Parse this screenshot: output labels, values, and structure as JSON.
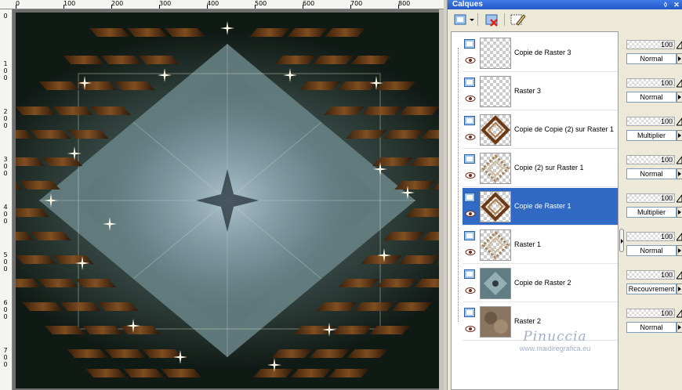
{
  "ruler": {
    "top_labels": [
      "0",
      "100",
      "200",
      "300",
      "400",
      "500",
      "600",
      "700",
      "800"
    ],
    "left_labels": [
      "0",
      "100",
      "200",
      "300",
      "400",
      "500",
      "600",
      "700"
    ]
  },
  "palette": {
    "title": "Calques",
    "title_buttons": {
      "pin": "◊",
      "close": "✕"
    },
    "tools": [
      "new-layer-icon",
      "delete-layer-icon",
      "edit-layer-icon"
    ]
  },
  "layers": [
    {
      "name": "Copie de Raster 3",
      "opacity": "100",
      "blend": "Normal",
      "thumb": "transparent",
      "selected": false
    },
    {
      "name": "Raster 3",
      "opacity": "100",
      "blend": "Normal",
      "thumb": "transparent",
      "selected": false
    },
    {
      "name": "Copie de Copie (2) sur Raster 1",
      "opacity": "100",
      "blend": "Multiplier",
      "thumb": "diamond-brown",
      "selected": false
    },
    {
      "name": "Copie (2) sur Raster 1",
      "opacity": "100",
      "blend": "Normal",
      "thumb": "diamond-light",
      "selected": false
    },
    {
      "name": "Copie de Raster 1",
      "opacity": "100",
      "blend": "Multiplier",
      "thumb": "diamond-brown",
      "selected": true
    },
    {
      "name": "Raster 1",
      "opacity": "100",
      "blend": "Normal",
      "thumb": "diamond-light",
      "selected": false
    },
    {
      "name": "Copie de Raster 2",
      "opacity": "100",
      "blend": "Recouvrement",
      "thumb": "teal-pattern",
      "selected": false
    },
    {
      "name": "Raster 2",
      "opacity": "100",
      "blend": "Normal",
      "thumb": "brown-pattern",
      "selected": false
    }
  ],
  "watermark": {
    "name": "Pinuccia",
    "url": "www.maidiregrafica.eu"
  },
  "colors": {
    "selection": "#316ac5",
    "titlebar": "#2b62d6",
    "canvas_center": "#7f97a0",
    "brick": "#6b3a14"
  }
}
